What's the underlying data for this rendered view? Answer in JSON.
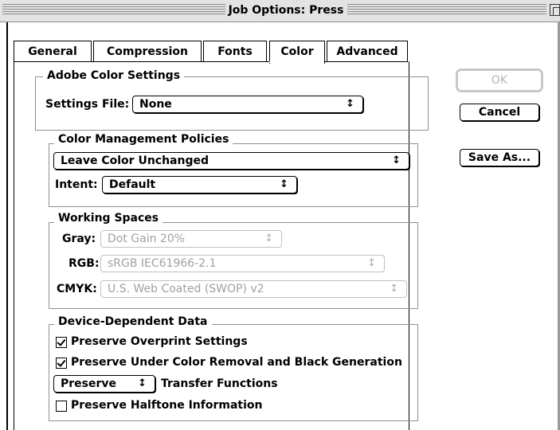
{
  "window": {
    "title": "Job Options: Press"
  },
  "tabs": [
    {
      "label": "General"
    },
    {
      "label": "Compression"
    },
    {
      "label": "Fonts"
    },
    {
      "label": "Color"
    },
    {
      "label": "Advanced"
    }
  ],
  "active_tab": "Color",
  "adobe_color_settings": {
    "title": "Adobe Color Settings",
    "settings_file_label": "Settings File:",
    "settings_file_value": "None"
  },
  "color_management_policies": {
    "title": "Color Management Policies",
    "policy_value": "Leave Color Unchanged",
    "intent_label": "Intent:",
    "intent_value": "Default"
  },
  "working_spaces": {
    "title": "Working Spaces",
    "gray_label": "Gray:",
    "gray_value": "Dot Gain 20%",
    "rgb_label": "RGB:",
    "rgb_value": "sRGB IEC61966-2.1",
    "cmyk_label": "CMYK:",
    "cmyk_value": "U.S. Web Coated (SWOP) v2"
  },
  "device_dependent_data": {
    "title": "Device-Dependent Data",
    "overprint_label": "Preserve Overprint Settings",
    "overprint_checked": true,
    "ucr_label": "Preserve Under Color Removal and Black Generation",
    "ucr_checked": true,
    "transfer_value": "Preserve",
    "transfer_label": "Transfer Functions",
    "halftone_label": "Preserve Halftone Information",
    "halftone_checked": false
  },
  "buttons": {
    "ok": "OK",
    "cancel": "Cancel",
    "save_as": "Save As..."
  },
  "popup_arrow_glyph": "↕"
}
